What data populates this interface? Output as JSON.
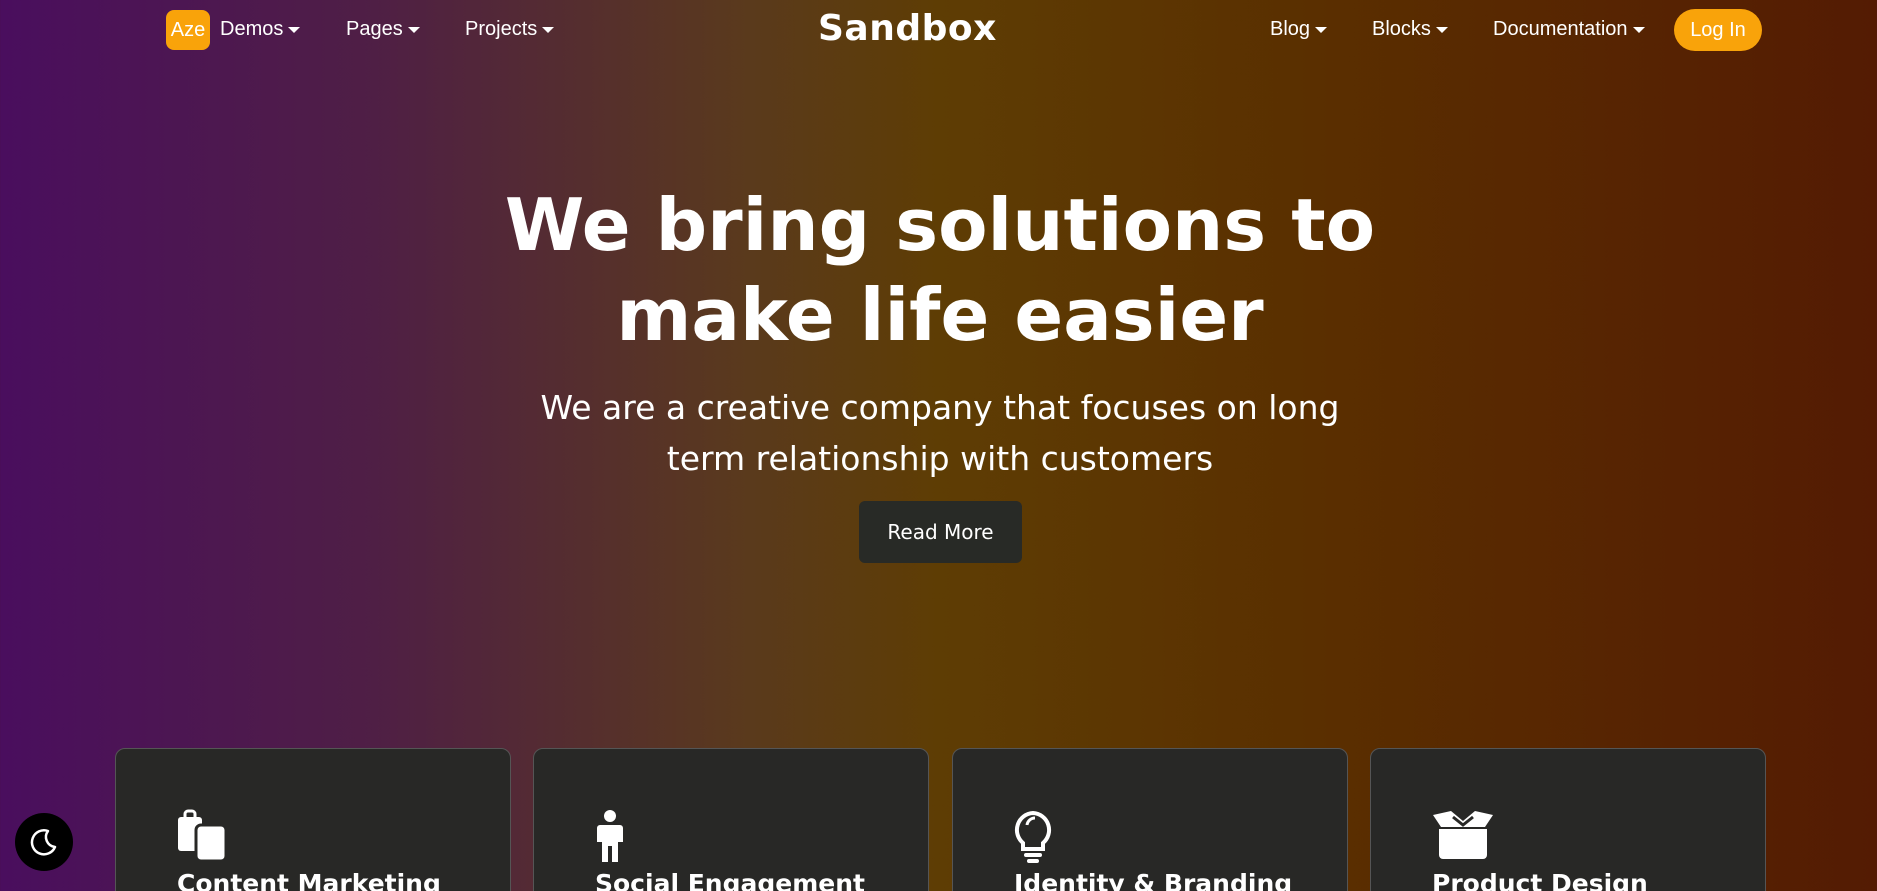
{
  "nav": {
    "badge": "Aze",
    "left_items": [
      "Demos",
      "Pages",
      "Projects"
    ],
    "brand": "Sandbox",
    "right_items": [
      "Blog",
      "Blocks",
      "Documentation"
    ],
    "login": "Log In"
  },
  "hero": {
    "title_line1": "We bring solutions to",
    "title_line2": "make life easier",
    "subtitle_line1": "We are a creative company that focuses on long",
    "subtitle_line2": "term relationship with customers",
    "button": "Read More"
  },
  "cards": [
    {
      "title": "Content Marketing",
      "icon": "clipboard-icon"
    },
    {
      "title": "Social Engagement",
      "icon": "person-icon"
    },
    {
      "title": "Identity & Branding",
      "icon": "lightbulb-icon"
    },
    {
      "title": "Product Design",
      "icon": "box-icon"
    }
  ],
  "theme_toggle_icon": "moon-icon",
  "colors": {
    "accent": "#f9a30a",
    "dark_button": "#282a26",
    "card_bg": "#282826"
  }
}
